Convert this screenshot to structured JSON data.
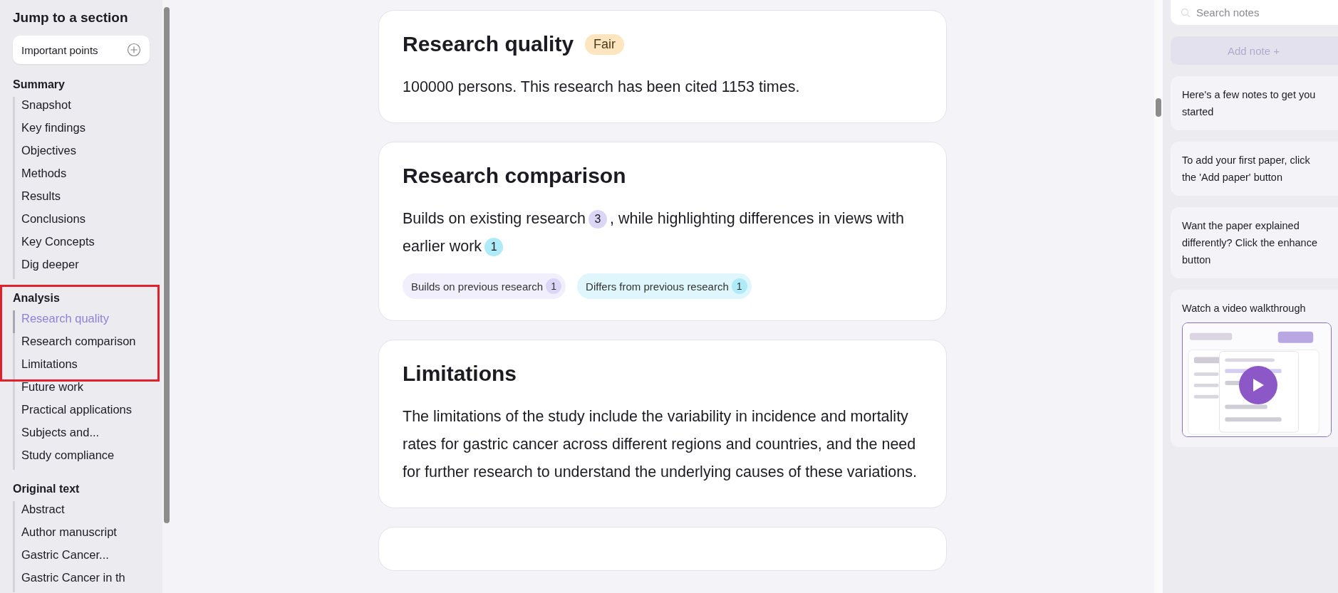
{
  "sidebar": {
    "title": "Jump to a section",
    "important_points": {
      "label": "Important points"
    },
    "sections": [
      {
        "heading": "Summary",
        "highlighted": false,
        "items": [
          {
            "label": "Snapshot",
            "selected": false
          },
          {
            "label": "Key findings",
            "selected": false
          },
          {
            "label": "Objectives",
            "selected": false
          },
          {
            "label": "Methods",
            "selected": false
          },
          {
            "label": "Results",
            "selected": false
          },
          {
            "label": "Conclusions",
            "selected": false
          },
          {
            "label": "Key Concepts",
            "selected": false
          },
          {
            "label": "Dig deeper",
            "selected": false
          }
        ]
      },
      {
        "heading": "Analysis",
        "highlighted": true,
        "items": [
          {
            "label": "Research quality",
            "selected": true
          },
          {
            "label": "Research comparison",
            "selected": false
          },
          {
            "label": "Limitations",
            "selected": false
          },
          {
            "label": "Future work",
            "selected": false
          },
          {
            "label": "Practical applications",
            "selected": false
          },
          {
            "label": "Subjects and...",
            "selected": false
          },
          {
            "label": "Study compliance",
            "selected": false
          }
        ]
      },
      {
        "heading": "Original text",
        "highlighted": false,
        "items": [
          {
            "label": "Abstract",
            "selected": false
          },
          {
            "label": "Author manuscript",
            "selected": false
          },
          {
            "label": "Gastric Cancer...",
            "selected": false
          },
          {
            "label": "Gastric Cancer in th",
            "selected": false
          }
        ]
      }
    ]
  },
  "cards": [
    {
      "kind": "quality",
      "title": "Research quality",
      "badge": {
        "label": "Fair",
        "color": "#fde6bf"
      },
      "text": "100000 persons. This research has been cited 1153 times."
    },
    {
      "kind": "comparison",
      "title": "Research comparison",
      "segments": [
        {
          "text": "Builds on existing research",
          "count": "3",
          "color": "#dcd6f6"
        },
        {
          "text": ", while highlighting differences in views with earlier work",
          "count": "1",
          "color": "#aeeaf8"
        }
      ],
      "chips": [
        {
          "label": "Builds on previous research",
          "count": "1",
          "color": "#dcd6f6"
        },
        {
          "label": "Differs from previous research",
          "count": "1",
          "color": "#aeeaf8"
        }
      ]
    },
    {
      "kind": "text",
      "title": "Limitations",
      "text": "The limitations of the study include the variability in incidence and mortality rates for gastric cancer across different regions and countries, and the need for further research to understand the underlying causes of these variations."
    }
  ],
  "notes": {
    "search": {
      "placeholder": "Search notes"
    },
    "add_button": {
      "label": "Add note +",
      "disabled": true
    },
    "items": [
      {
        "kind": "text",
        "text": "Here's a few notes to get you started"
      },
      {
        "kind": "text",
        "text": "To add your first paper, click the 'Add paper' button"
      },
      {
        "kind": "text",
        "text": "Want the paper explained differently? Click the enhance button"
      },
      {
        "kind": "video",
        "text": "Watch a video walkthrough"
      }
    ]
  }
}
